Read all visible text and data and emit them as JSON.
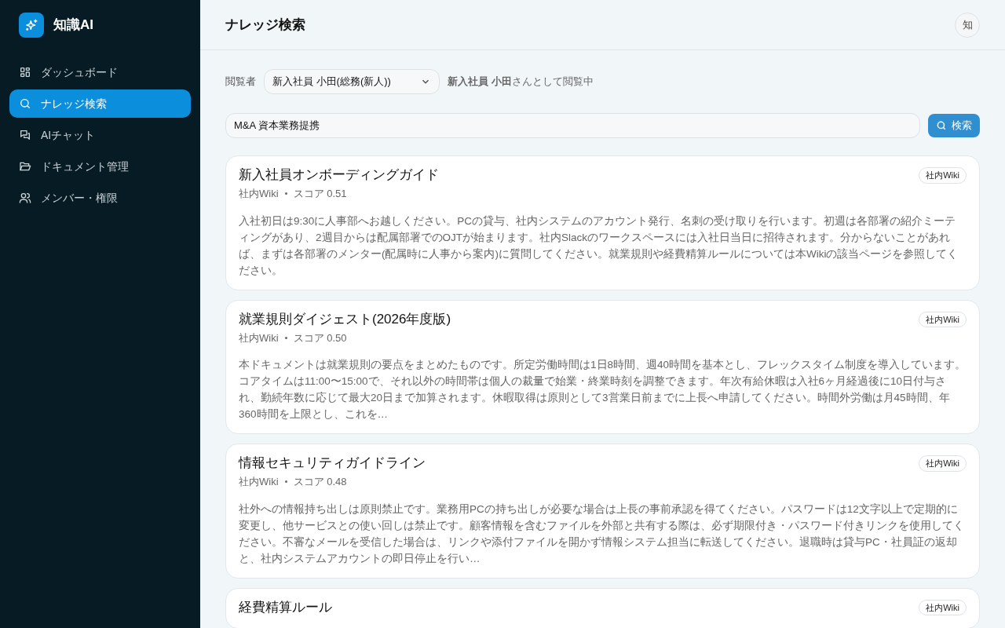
{
  "app": {
    "name": "知識AI"
  },
  "sidebar": {
    "items": [
      {
        "label": "ダッシュボード",
        "selected": false
      },
      {
        "label": "ナレッジ検索",
        "selected": true
      },
      {
        "label": "AIチャット",
        "selected": false
      },
      {
        "label": "ドキュメント管理",
        "selected": false
      },
      {
        "label": "メンバー・権限",
        "selected": false
      }
    ]
  },
  "header": {
    "title": "ナレッジ検索",
    "avatar": "知"
  },
  "viewer": {
    "label": "閲覧者",
    "value": "新入社員 小田(総務(新人))",
    "status": "**新入社員 小田**さんとして閲覧中"
  },
  "search": {
    "value": "M&A 資本業務提携",
    "button": "検索"
  },
  "results": [
    {
      "title": "新入社員オンボーディングガイド",
      "badge": "社内Wiki",
      "source": "社内Wiki",
      "score": "スコア 0.51",
      "snippet": "入社初日は9:30に人事部へお越しください。PCの貸与、社内システムのアカウント発行、名刺の受け取りを行います。初週は各部署の紹介ミーティングがあり、2週目からは配属部署でのOJTが始まります。社内Slackのワークスペースには入社日当日に招待されます。分からないことがあれば、まずは各部署のメンター(配属時に人事から案内)に質問してください。就業規則や経費精算ルールについては本Wikiの該当ページを参照してください。"
    },
    {
      "title": "就業規則ダイジェスト(2026年度版)",
      "badge": "社内Wiki",
      "source": "社内Wiki",
      "score": "スコア 0.50",
      "snippet": "本ドキュメントは就業規則の要点をまとめたものです。所定労働時間は1日8時間、週40時間を基本とし、フレックスタイム制度を導入しています。コアタイムは11:00〜15:00で、それ以外の時間帯は個人の裁量で始業・終業時刻を調整できます。年次有給休暇は入社6ヶ月経過後に10日付与され、勤続年数に応じて最大20日まで加算されます。休暇取得は原則として3営業日前までに上長へ申請してください。時間外労働は月45時間、年360時間を上限とし、これを…"
    },
    {
      "title": "情報セキュリティガイドライン",
      "badge": "社内Wiki",
      "source": "社内Wiki",
      "score": "スコア 0.48",
      "snippet": "社外への情報持ち出しは原則禁止です。業務用PCの持ち出しが必要な場合は上長の事前承認を得てください。パスワードは12文字以上で定期的に変更し、他サービスとの使い回しは禁止です。顧客情報を含むファイルを外部と共有する際は、必ず期限付き・パスワード付きリンクを使用してください。不審なメールを受信した場合は、リンクや添付ファイルを開かず情報システム担当に転送してください。退職時は貸与PC・社員証の返却と、社内システムアカウントの即日停止を行い…"
    },
    {
      "title": "経費精算ルール",
      "badge": "社内Wiki"
    }
  ]
}
